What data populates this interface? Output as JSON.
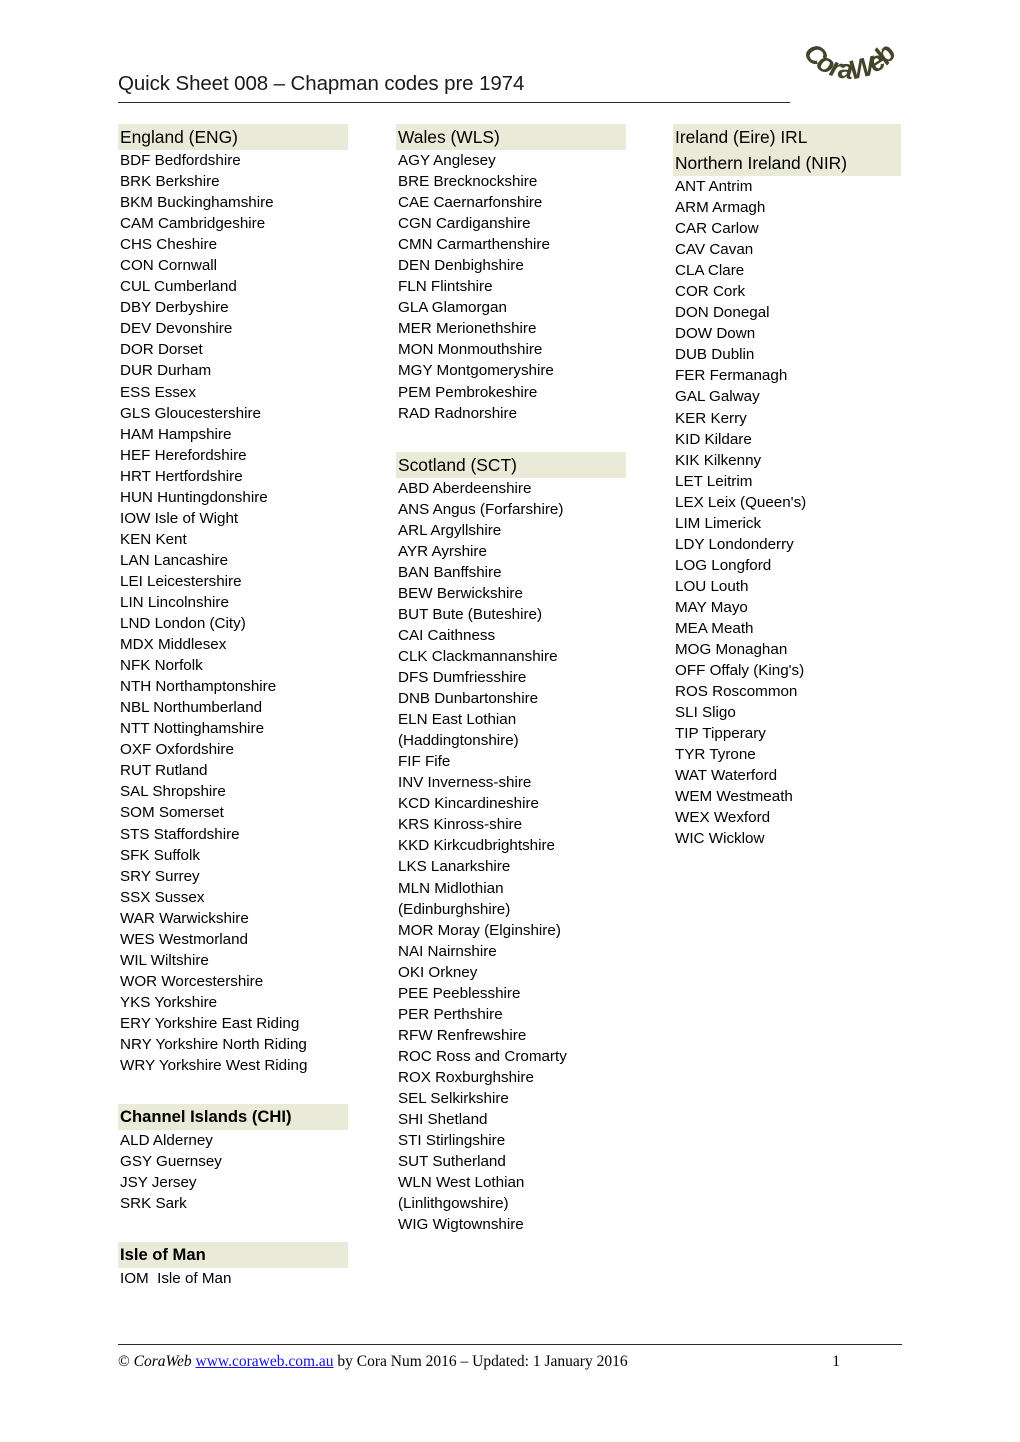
{
  "document": {
    "title": "Quick Sheet 008 – Chapman codes pre 1974",
    "logo_text": "CoraWeb",
    "highlight_color": "#e9ead7",
    "link_color": "#1414d6"
  },
  "columns": {
    "england": {
      "heading": "England  (ENG)",
      "items": [
        "BDF Bedfordshire",
        "BRK Berkshire",
        "BKM Buckinghamshire",
        "CAM Cambridgeshire",
        "CHS Cheshire",
        "CON Cornwall",
        "CUL Cumberland",
        "DBY Derbyshire",
        "DEV Devonshire",
        "DOR Dorset",
        "DUR Durham",
        "ESS Essex",
        "GLS Gloucestershire",
        "HAM Hampshire",
        "HEF Herefordshire",
        "HRT Hertfordshire",
        "HUN Huntingdonshire",
        "IOW Isle of Wight",
        "KEN Kent",
        "LAN Lancashire",
        "LEI Leicestershire",
        "LIN Lincolnshire",
        "LND London (City)",
        "MDX Middlesex",
        "NFK Norfolk",
        "NTH Northamptonshire",
        "NBL Northumberland",
        "NTT Nottinghamshire",
        "OXF Oxfordshire",
        "RUT Rutland",
        "SAL Shropshire",
        "SOM Somerset",
        "STS Staffordshire",
        "SFK Suffolk",
        "SRY Surrey",
        "SSX Sussex",
        "WAR Warwickshire",
        "WES Westmorland",
        "WIL Wiltshire",
        "WOR Worcestershire",
        "YKS Yorkshire",
        "ERY Yorkshire East Riding",
        "NRY Yorkshire North Riding",
        "WRY Yorkshire West Riding"
      ]
    },
    "channel_islands": {
      "heading": "Channel Islands (CHI)",
      "items": [
        "ALD Alderney",
        "GSY Guernsey",
        "JSY Jersey",
        "SRK Sark"
      ]
    },
    "isle_of_man": {
      "heading": "Isle of Man",
      "items": [
        "IOM  Isle of Man"
      ]
    },
    "wales": {
      "heading": "Wales (WLS)",
      "items": [
        "AGY Anglesey",
        "BRE Brecknockshire",
        "CAE Caernarfonshire",
        "CGN Cardiganshire",
        "CMN Carmarthenshire",
        "DEN Denbighshire",
        "FLN Flintshire",
        "GLA Glamorgan",
        "MER Merionethshire",
        "MON Monmouthshire",
        "MGY Montgomeryshire",
        "PEM Pembrokeshire",
        "RAD Radnorshire"
      ]
    },
    "scotland": {
      "heading": "Scotland (SCT)",
      "items": [
        "ABD Aberdeenshire",
        "ANS Angus (Forfarshire)",
        "ARL Argyllshire",
        "AYR Ayrshire",
        "BAN Banffshire",
        "BEW Berwickshire",
        "BUT Bute (Buteshire)",
        "CAI Caithness",
        "CLK Clackmannanshire",
        "DFS Dumfriesshire",
        "DNB Dunbartonshire",
        "ELN East Lothian\n(Haddingtonshire)",
        "FIF Fife",
        "INV Inverness-shire",
        "KCD Kincardineshire",
        "KRS Kinross-shire",
        "KKD Kirkcudbrightshire",
        "LKS Lanarkshire",
        "MLN Midlothian\n(Edinburghshire)",
        "MOR Moray (Elginshire)",
        "NAI Nairnshire",
        "OKI Orkney",
        "PEE Peeblesshire",
        "PER Perthshire",
        "RFW Renfrewshire",
        "ROC Ross and Cromarty",
        "ROX Roxburghshire",
        "SEL Selkirkshire",
        "SHI Shetland",
        "STI Stirlingshire",
        "SUT Sutherland",
        "WLN West Lothian\n(Linlithgowshire)",
        "WIG Wigtownshire"
      ]
    },
    "ireland": {
      "heading_line1": "Ireland (Eire) IRL",
      "heading_line2": "Northern Ireland (NIR)",
      "items": [
        "ANT Antrim",
        "ARM Armagh",
        "CAR Carlow",
        "CAV Cavan",
        "CLA Clare",
        "COR Cork",
        "DON Donegal",
        "DOW Down",
        "DUB Dublin",
        "FER Fermanagh",
        "GAL Galway",
        "KER Kerry",
        "KID Kildare",
        "KIK Kilkenny",
        "LET Leitrim",
        "LEX Leix (Queen's)",
        "LIM Limerick",
        "LDY Londonderry",
        "LOG Longford",
        "LOU Louth",
        "MAY Mayo",
        "MEA Meath",
        "MOG Monaghan",
        "OFF Offaly (King's)",
        "ROS Roscommon",
        "SLI Sligo",
        "TIP Tipperary",
        "TYR Tyrone",
        "WAT Waterford",
        "WEM Westmeath",
        "WEX Wexford",
        "WIC Wicklow"
      ]
    }
  },
  "footer": {
    "copyright_symbol": "©",
    "brand": "CoraWeb",
    "url": "www.coraweb.com.au",
    "credit": "by Cora Num 2016 – Updated: 1 January 2016",
    "page_number": "1"
  }
}
